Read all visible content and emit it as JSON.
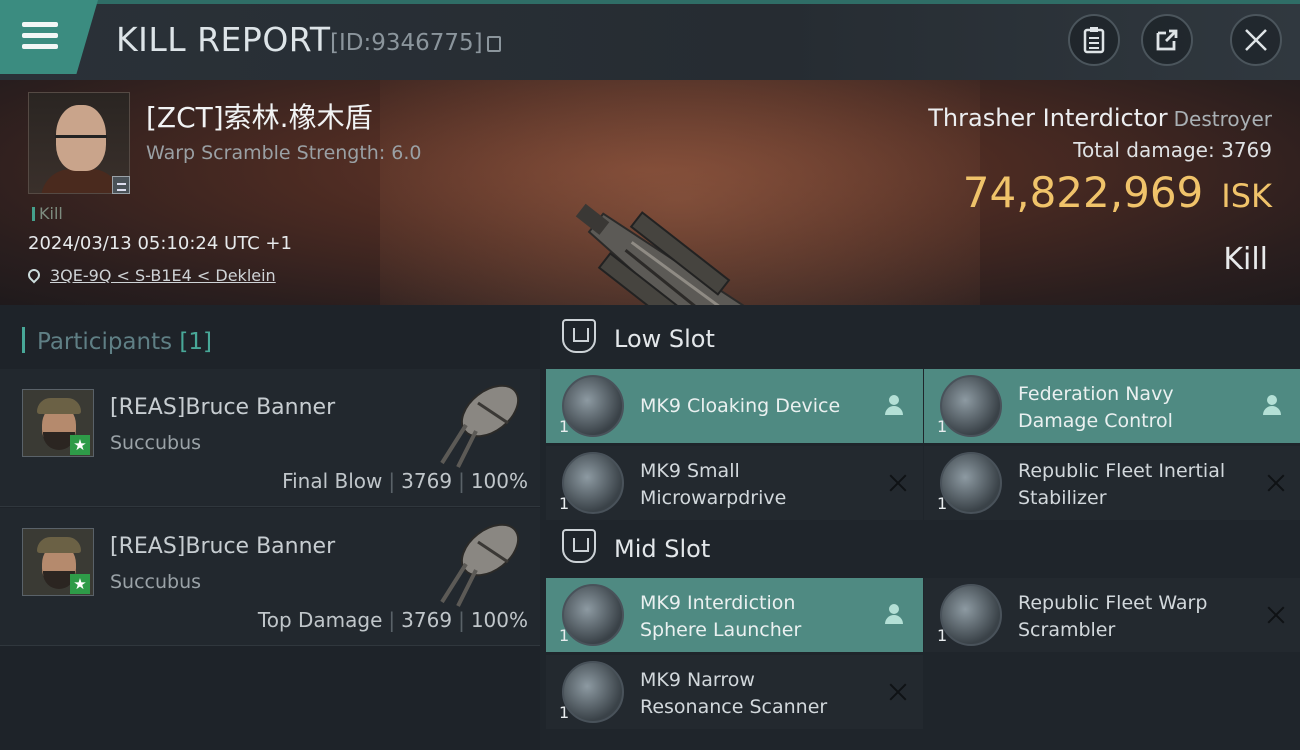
{
  "header": {
    "title": "KILL REPORT",
    "report_id": "[ID:9346775]",
    "icons": [
      "menu-icon",
      "copy-icon",
      "clipboard-icon",
      "export-icon",
      "close-icon"
    ]
  },
  "victim": {
    "name": "[ZCT]索林.橡木盾",
    "subtitle": "Warp Scramble Strength: 6.0",
    "kill_tag": "Kill",
    "timestamp": "2024/03/13 05:10:24 UTC +1",
    "location": "3QE-9Q < S-B1E4 < Deklein"
  },
  "ship": {
    "name": "Thrasher Interdictor",
    "class": "Destroyer",
    "total_damage_label": "Total damage:",
    "total_damage": "3769",
    "isk_value": "74,822,969",
    "isk_label": "ISK",
    "result": "Kill"
  },
  "participants": {
    "label": "Participants",
    "count": "[1]",
    "list": [
      {
        "name": "[REAS]Bruce Banner",
        "ship": "Succubus",
        "role": "Final Blow",
        "damage": "3769",
        "percent": "100%"
      },
      {
        "name": "[REAS]Bruce Banner",
        "ship": "Succubus",
        "role": "Top Damage",
        "damage": "3769",
        "percent": "100%"
      }
    ]
  },
  "slots": {
    "low": {
      "label": "Low Slot",
      "modules": [
        {
          "name_line1": "MK9 Cloaking Device",
          "name_line2": "",
          "qty": "1",
          "status": "dropped"
        },
        {
          "name_line1": "Federation Navy",
          "name_line2": "Damage Control",
          "qty": "1",
          "status": "dropped"
        },
        {
          "name_line1": "MK9 Small",
          "name_line2": "Microwarpdrive",
          "qty": "1",
          "status": "destroyed"
        },
        {
          "name_line1": "Republic Fleet Inertial",
          "name_line2": "Stabilizer",
          "qty": "1",
          "status": "destroyed"
        }
      ]
    },
    "mid": {
      "label": "Mid Slot",
      "modules": [
        {
          "name_line1": "MK9 Interdiction",
          "name_line2": "Sphere Launcher",
          "qty": "1",
          "status": "dropped"
        },
        {
          "name_line1": "Republic Fleet Warp",
          "name_line2": "Scrambler",
          "qty": "1",
          "status": "destroyed"
        },
        {
          "name_line1": "MK9 Narrow",
          "name_line2": "Resonance Scanner",
          "qty": "1",
          "status": "destroyed"
        }
      ]
    }
  },
  "colors": {
    "accent_teal": "#3b8c80",
    "isk_gold": "#f0c36a",
    "dropped_row": "#4f8a82"
  }
}
